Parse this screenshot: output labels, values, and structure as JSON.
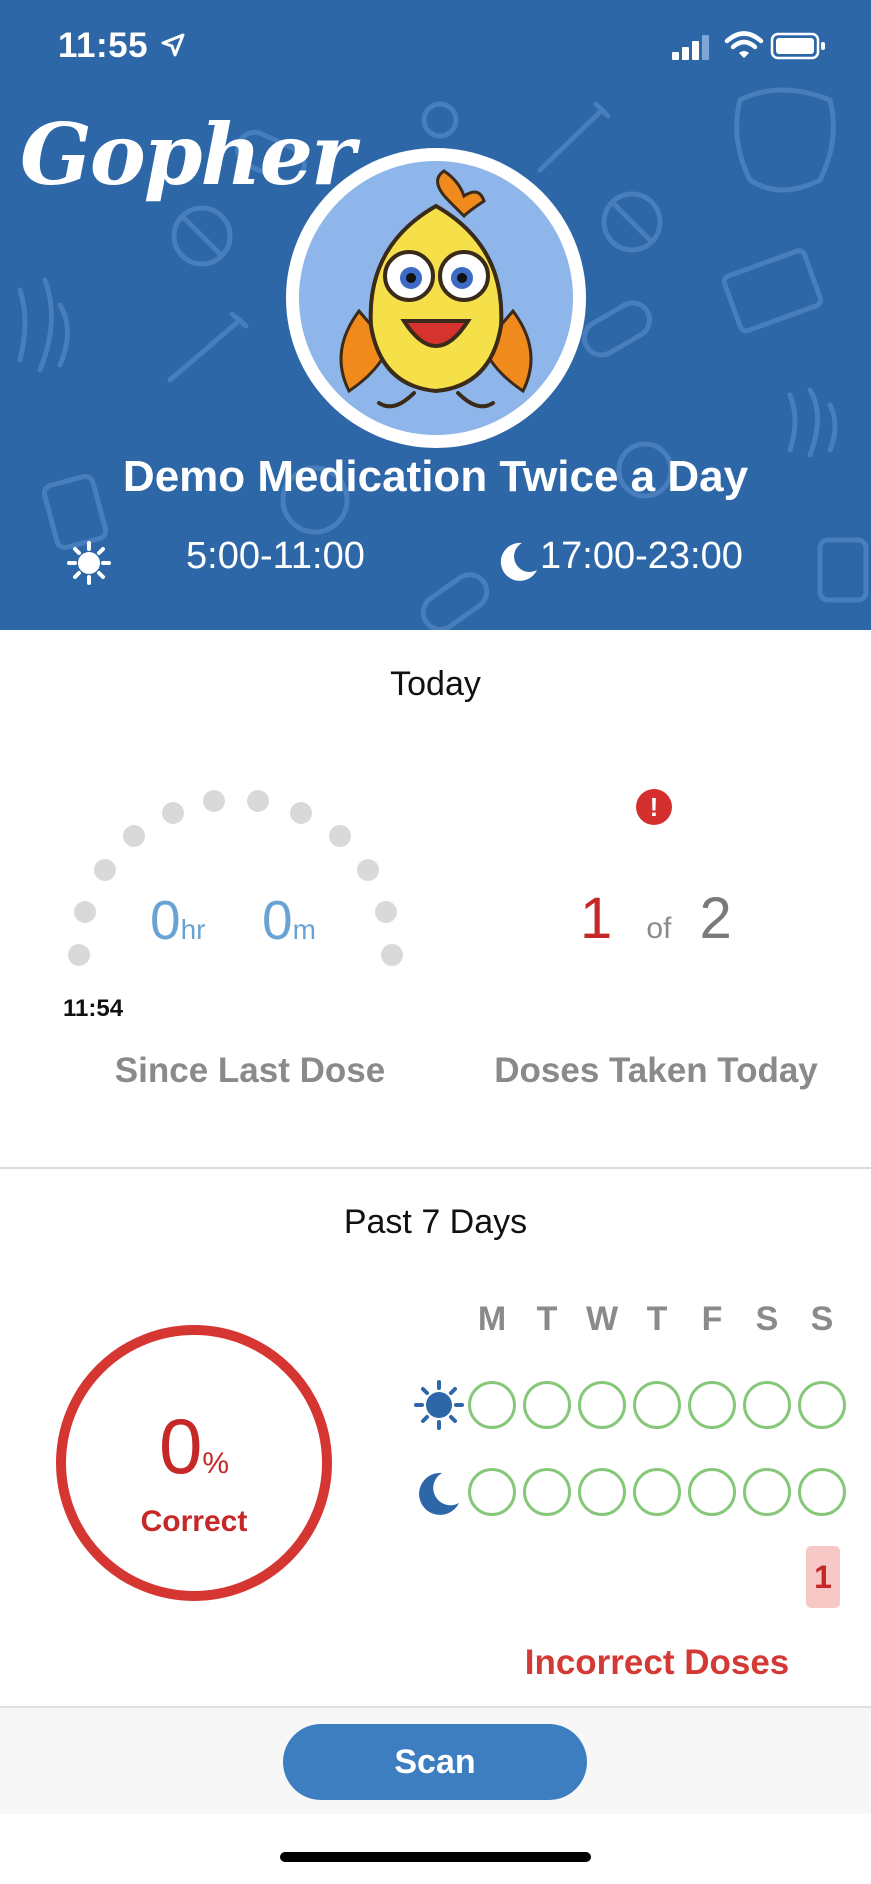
{
  "status_bar": {
    "time": "11:55"
  },
  "header": {
    "logo": "Gopher",
    "medication_name": "Demo Medication Twice a Day",
    "morning_window": "5:00-11:00",
    "evening_window": "17:00-23:00"
  },
  "today": {
    "title": "Today",
    "timer_hours": "0",
    "timer_hours_unit": "hr",
    "timer_minutes": "0",
    "timer_minutes_unit": "m",
    "last_dose_time": "11:54",
    "since_label": "Since Last Dose",
    "doses_taken": "1",
    "doses_of": "of",
    "doses_total": "2",
    "doses_label": "Doses Taken Today",
    "alert_icon": "!"
  },
  "past7": {
    "title": "Past 7 Days",
    "percent": "0",
    "percent_sign": "%",
    "correct_label": "Correct",
    "days": [
      "M",
      "T",
      "W",
      "T",
      "F",
      "S",
      "S"
    ],
    "incorrect_count": "1",
    "incorrect_label": "Incorrect Doses"
  },
  "footer": {
    "scan_label": "Scan"
  },
  "colors": {
    "header_blue": "#2d67a8",
    "timer_blue": "#6aa3d2",
    "alert_red": "#d32f2f",
    "ring_red": "#d63631",
    "week_green": "#86c77a",
    "button_blue": "#3d7ec1"
  }
}
